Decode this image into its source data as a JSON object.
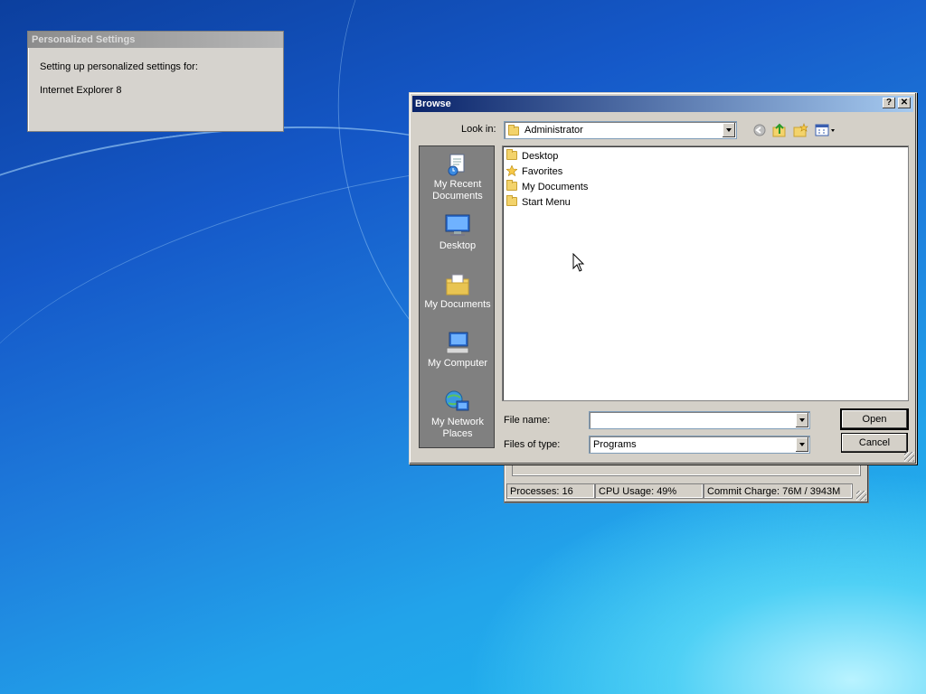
{
  "personalized": {
    "title": "Personalized Settings",
    "line1": "Setting up personalized settings for:",
    "line2": "Internet Explorer 8"
  },
  "taskmgr": {
    "processes": "Processes: 16",
    "cpu": "CPU Usage: 49%",
    "commit": "Commit Charge: 76M / 3943M"
  },
  "browse": {
    "title": "Browse",
    "help_label": "?",
    "close_label": "✕",
    "look_in_label": "Look in:",
    "look_in_value": "Administrator",
    "places": [
      {
        "label": "My Recent Documents",
        "icon": "recent-documents-icon"
      },
      {
        "label": "Desktop",
        "icon": "desktop-icon"
      },
      {
        "label": "My Documents",
        "icon": "my-documents-icon"
      },
      {
        "label": "My Computer",
        "icon": "my-computer-icon"
      },
      {
        "label": "My Network Places",
        "icon": "network-places-icon"
      }
    ],
    "files": [
      {
        "name": "Desktop",
        "icon": "folder-icon"
      },
      {
        "name": "Favorites",
        "icon": "star-icon"
      },
      {
        "name": "My Documents",
        "icon": "folder-icon"
      },
      {
        "name": "Start Menu",
        "icon": "folder-icon"
      }
    ],
    "file_name_label": "File name:",
    "file_name_value": "",
    "files_of_type_label": "Files of type:",
    "files_of_type_value": "Programs",
    "open_label": "Open",
    "cancel_label": "Cancel"
  }
}
